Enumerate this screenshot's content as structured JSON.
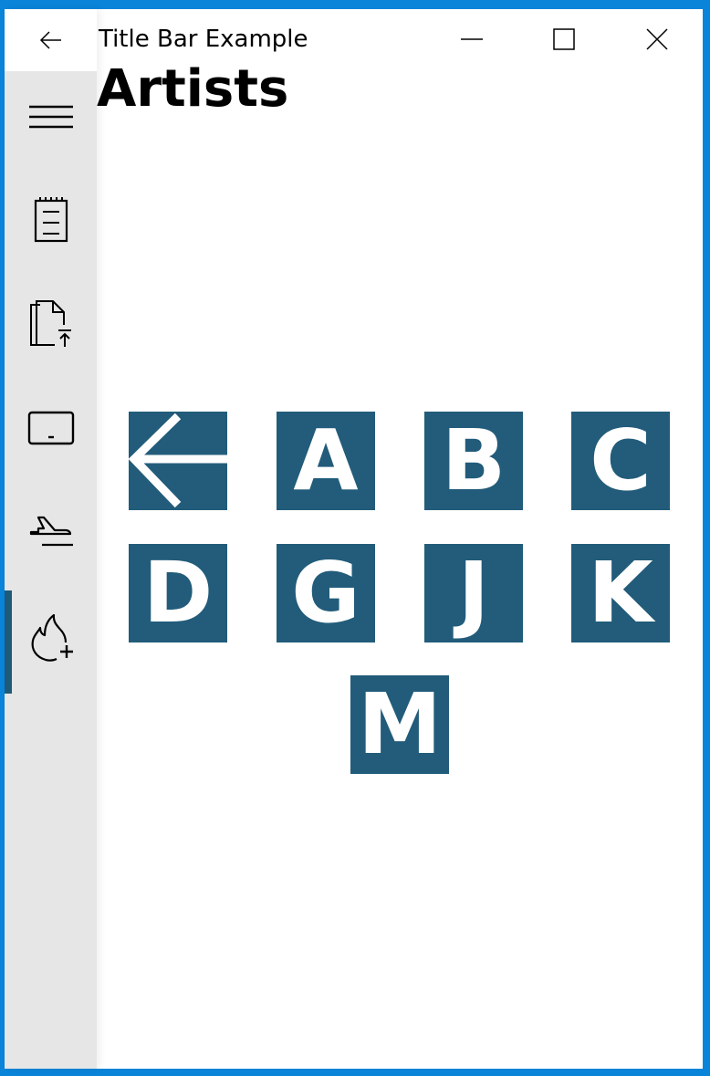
{
  "window": {
    "title": "Title Bar Example"
  },
  "page": {
    "heading": "Artists"
  },
  "nav": {
    "items": [
      "menu-icon",
      "notepad-icon",
      "copy-upload-icon",
      "tablet-icon",
      "airplane-landing-icon",
      "fire-add-icon"
    ],
    "selected_index": 5
  },
  "tiles": [
    {
      "label": "",
      "icon": "back-arrow-icon"
    },
    {
      "label": "A"
    },
    {
      "label": "B"
    },
    {
      "label": "C"
    },
    {
      "label": "D"
    },
    {
      "label": "G"
    },
    {
      "label": "J"
    },
    {
      "label": "K"
    },
    {
      "label": "M"
    }
  ],
  "colors": {
    "accent": "#225c7a",
    "frame": "#0a84d8",
    "nav_bg": "#e6e6e6"
  }
}
